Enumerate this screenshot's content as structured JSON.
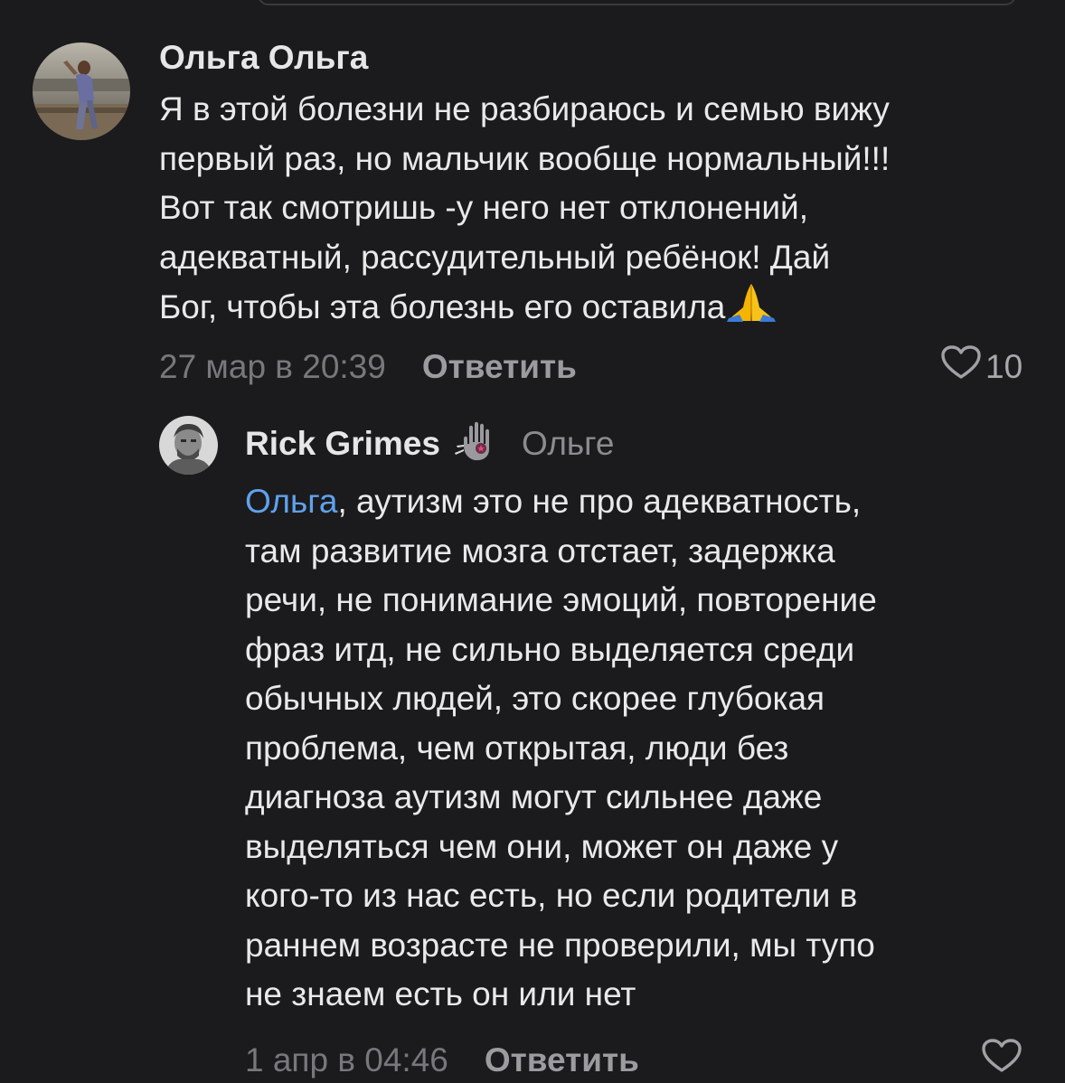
{
  "comments": [
    {
      "author": "Ольга Ольга",
      "avatar_icon": "avatar-photo-icon",
      "text_lines": [
        "Я в этой болезни не разбираюсь и семью вижу",
        "первый раз, но мальчик вообще нормальный!!!",
        "Вот так смотришь -у него нет отклонений,",
        "адекватный, рассудительный ребёнок! Дай",
        "Бог, чтобы эта болезнь его оставила"
      ],
      "emoji_icon": "folded-hands-icon",
      "timestamp": "27 мар в 20:39",
      "reply_label": "Ответить",
      "likes": "10",
      "like_icon": "heart-outline-icon"
    },
    {
      "author": "Rick Grimes",
      "author_emoji_icon": "raised-hand-icon",
      "avatar_icon": "avatar-photo-icon",
      "reply_to": "Ольге",
      "mention": "Ольга",
      "first_line_rest": ", аутизм это не про адекватность,",
      "text_lines": [
        "там развитие мозга отстает, задержка",
        "речи, не понимание эмоций, повторение",
        "фраз итд, не сильно выделяется среди",
        "обычных людей, это скорее глубокая",
        "проблема, чем открытая, люди без",
        "диагноза аутизм могут сильнее даже",
        "выделяться чем они, может он даже у",
        "кого-то из нас есть, но если родители в",
        "раннем возрасте не проверили, мы тупо",
        "не знаем есть он или нет"
      ],
      "timestamp": "1 апр в 04:46",
      "reply_label": "Ответить",
      "like_icon": "heart-outline-icon"
    }
  ],
  "colors": {
    "background": "#1b1b1d",
    "text": "#e9e9ea",
    "muted": "#78787c",
    "mention": "#5fa2ee"
  }
}
